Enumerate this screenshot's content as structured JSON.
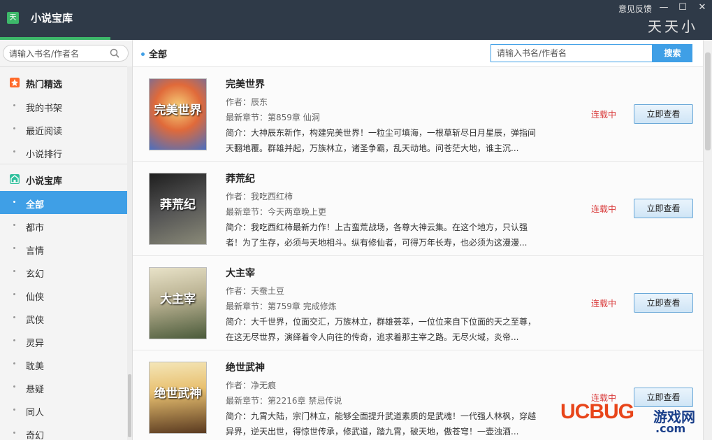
{
  "app": {
    "title": "小说宝库",
    "icon_text": "天",
    "feedback": "意见反馈",
    "brand_logo_text": "天天小说"
  },
  "sidebar": {
    "search_placeholder": "请输入书名/作者名",
    "sections": [
      {
        "label": "热门精选",
        "icon": "hot-icon",
        "icon_color": "#ff6a2a",
        "items": [
          {
            "label": "我的书架"
          },
          {
            "label": "最近阅读"
          },
          {
            "label": "小说排行"
          }
        ]
      },
      {
        "label": "小说宝库",
        "icon": "library-icon",
        "icon_color": "#2fbf9c",
        "items": [
          {
            "label": "全部",
            "active": true
          },
          {
            "label": "都市"
          },
          {
            "label": "言情"
          },
          {
            "label": "玄幻"
          },
          {
            "label": "仙侠"
          },
          {
            "label": "武侠"
          },
          {
            "label": "灵异"
          },
          {
            "label": "耽美"
          },
          {
            "label": "悬疑"
          },
          {
            "label": "同人"
          },
          {
            "label": "奇幻"
          }
        ]
      }
    ]
  },
  "main": {
    "breadcrumb": "全部",
    "search_placeholder": "请输入书名/作者名",
    "search_button": "搜索",
    "view_button": "立即查看",
    "books": [
      {
        "title": "完美世界",
        "author": "作者：辰东",
        "latest": "最新章节：第859章  仙洞",
        "desc": "简介：大神辰东新作，构建完美世界！一粒尘可填海，一根草斩尽日月星辰，弹指间天翻地覆。群雄并起，万族林立，诸圣争霸，乱天动地。问苍茫大地，谁主沉...",
        "status": "连载中",
        "cover_text": "完美世界",
        "cover_colors": [
          "#e06a3a",
          "#4a6fc0"
        ]
      },
      {
        "title": "莽荒纪",
        "author": "作者：我吃西红柿",
        "latest": "最新章节：今天两章晚上更",
        "desc": "简介：我吃西红柿最新力作！上古蛮荒战场，各尊大神云集。在这个地方，只认强者！为了生存，必须与天地相斗。纵有修仙者，可得万年长寿，也必须为这漫漫...",
        "status": "连载中",
        "cover_text": "莽荒纪",
        "cover_colors": [
          "#2a2a2a",
          "#7a7a6a"
        ]
      },
      {
        "title": "大主宰",
        "author": "作者：天蚕土豆",
        "latest": "最新章节：第759章  完成修炼",
        "desc": "简介：大千世界，位面交汇，万族林立，群雄荟萃，一位位来自下位面的天之至尊，在这无尽世界，演绎着令人向往的传奇，追求着那主宰之路。无尽火域，炎帝...",
        "status": "连载中",
        "cover_text": "大主宰",
        "cover_colors": [
          "#d8d0b0",
          "#5a6a4a"
        ]
      },
      {
        "title": "绝世武神",
        "author": "作者：净无痕",
        "latest": "最新章节：第2216章  禁忌传说",
        "desc": "简介：九霄大陆，宗门林立，能够全面提升武道素质的是武魂！一代强人林枫，穿越异界，逆天出世，得惊世传承，修武道，踏九霄，破天地，傲苍穹！一壶浊酒...",
        "status": "连载中",
        "cover_text": "绝世武神",
        "cover_colors": [
          "#e8c070",
          "#5a3a20"
        ]
      }
    ]
  },
  "watermark": {
    "brand": "UCBUG",
    "cn": "游戏网",
    "domain": ".com",
    "brand_color": "#e8451a",
    "cn_color": "#1a3f8a"
  }
}
